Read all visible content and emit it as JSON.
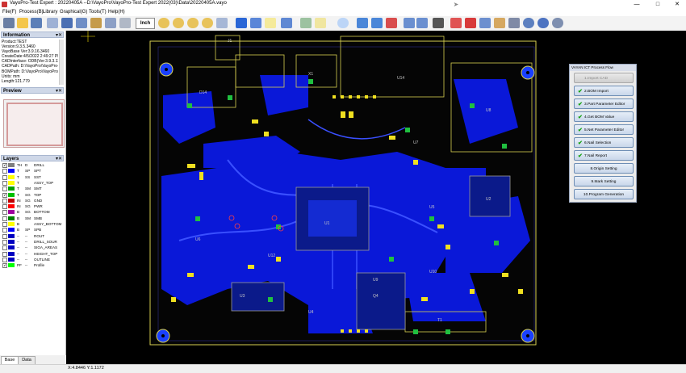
{
  "window": {
    "title": "VayoPro-Test Expert : 20220405A   --D:\\VayoPro\\VayoPro-Test Expert 2022(03)\\Data\\20220405A.vayo",
    "min": "—",
    "max": "□",
    "close": "✕"
  },
  "menu": [
    "File(F)",
    "Process(B)",
    "Library",
    "Graphical(G)",
    "Tools(T)",
    "Help(H)"
  ],
  "toolbar": {
    "unit": "Inch"
  },
  "info": {
    "header": "Information",
    "lines": [
      "Product:TEST",
      "Version:9.3.5.3460",
      "VayoBase Ver:3.9.16.3460",
      "CreateDate:4/5/2022 2:49:27 PM",
      "CADInterface: ODB(Ver:3.9.3.11)",
      "CADPath: D:\\VayoPro\\VayoPro-T",
      "BOMPath: D:\\VayoPro\\VayoPro-T",
      "Units: mm",
      "Length:121.779"
    ]
  },
  "preview": {
    "header": "Preview"
  },
  "layers": {
    "header": "Layers",
    "rows": [
      {
        "checked": true,
        "color": "#7f7f7f",
        "code": "TH",
        "kind": "D",
        "name": "DRILL"
      },
      {
        "checked": false,
        "color": "#0000ff",
        "code": "T",
        "kind": "SP",
        "name": "SPT"
      },
      {
        "checked": false,
        "color": "#ffff00",
        "code": "T",
        "kind": "SS",
        "name": "SST"
      },
      {
        "checked": false,
        "color": "#ffff00",
        "code": "T",
        "kind": "",
        "name": "ASSY_TOP"
      },
      {
        "checked": false,
        "color": "#00a000",
        "code": "T",
        "kind": "SM",
        "name": "SMT"
      },
      {
        "checked": true,
        "color": "#00c000",
        "code": "T",
        "kind": "SG",
        "name": "TOP"
      },
      {
        "checked": false,
        "color": "#c00000",
        "code": "IN",
        "kind": "SG",
        "name": "GND"
      },
      {
        "checked": false,
        "color": "#ff0000",
        "code": "IN",
        "kind": "SG",
        "name": "PWR"
      },
      {
        "checked": false,
        "color": "#a000a0",
        "code": "B",
        "kind": "SG",
        "name": "BOTTOM"
      },
      {
        "checked": false,
        "color": "#008000",
        "code": "B",
        "kind": "SM",
        "name": "SMB"
      },
      {
        "checked": false,
        "color": "#ffff00",
        "code": "B",
        "kind": "",
        "name": "ASSY_BOTTOM"
      },
      {
        "checked": false,
        "color": "#0000ff",
        "code": "B",
        "kind": "SP",
        "name": "SPB"
      },
      {
        "checked": false,
        "color": "#0000c0",
        "code": "--",
        "kind": "--",
        "name": "ROUT"
      },
      {
        "checked": false,
        "color": "#0000c0",
        "code": "--",
        "kind": "--",
        "name": "DRILL_SOUR"
      },
      {
        "checked": false,
        "color": "#0000c0",
        "code": "--",
        "kind": "--",
        "name": "SIGA_AREAS"
      },
      {
        "checked": false,
        "color": "#0000c0",
        "code": "--",
        "kind": "--",
        "name": "HEIGHT_TOP"
      },
      {
        "checked": false,
        "color": "#0000c0",
        "code": "--",
        "kind": "--",
        "name": "OUTLINE"
      },
      {
        "checked": true,
        "color": "#00ff00",
        "code": "PF",
        "kind": "--",
        "name": "Profile"
      }
    ]
  },
  "tabs": [
    "Base",
    "Data"
  ],
  "status": {
    "coord": "X:4.8446 Y:1.1172"
  },
  "flow": {
    "title": "VAYAN ICT Process Flow",
    "steps": [
      {
        "label": "1.Import CAD",
        "state": "dis"
      },
      {
        "label": "2.BOM Import",
        "state": "done"
      },
      {
        "label": "3.Part Parameter Editor",
        "state": "done"
      },
      {
        "label": "4.Get BOM Value",
        "state": "done"
      },
      {
        "label": "5.Net Parameter Editor",
        "state": "done"
      },
      {
        "label": "6.Nail Selection",
        "state": "done"
      },
      {
        "label": "7.Nail Report",
        "state": "done"
      },
      {
        "label": "8.Origin Setting",
        "state": "todo"
      },
      {
        "label": "9.Mark Setting",
        "state": "todo"
      },
      {
        "label": "10.Program Generation",
        "state": "todo"
      }
    ]
  },
  "board": {
    "designators": [
      "D14",
      "Q4",
      "U1",
      "U2",
      "U3",
      "U4",
      "U5",
      "U6",
      "U7",
      "U8",
      "U9",
      "U10",
      "U12",
      "U14",
      "X1",
      "J1",
      "T1"
    ]
  }
}
